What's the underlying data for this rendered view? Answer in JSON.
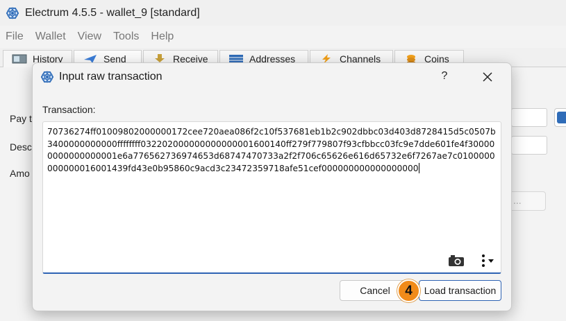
{
  "window": {
    "title": "Electrum 4.5.5  -  wallet_9  [standard]"
  },
  "menu": {
    "items": [
      "File",
      "Wallet",
      "View",
      "Tools",
      "Help"
    ]
  },
  "tabs": [
    {
      "label": "History",
      "icon": "history-icon"
    },
    {
      "label": "Send",
      "icon": "send-icon"
    },
    {
      "label": "Receive",
      "icon": "receive-icon"
    },
    {
      "label": "Addresses",
      "icon": "addresses-icon"
    },
    {
      "label": "Channels",
      "icon": "channels-icon"
    },
    {
      "label": "Coins",
      "icon": "coins-icon"
    }
  ],
  "send_form": {
    "pay_to_label": "Pay t",
    "description_label": "Desc",
    "amount_label": "Amo",
    "more_button": "..."
  },
  "dialog": {
    "title": "Input raw transaction",
    "help": "?",
    "transaction_label": "Transaction:",
    "transaction_text": "70736274ff01009802000000172cee720aea086f2c10f537681eb1b2c902dbbc03d403d8728415d5c0507b3400000000000ffffffff032202000000000000001600140ff279f779807f93cfbbcc03fc9e7dde601fe4f300000000000000001e6a776562736974653d68747470733a2f2f706c65626e616d65732e6f7267ae7c0100000000000016001439fd43e0b95860c9acd3c23472359718afe51cef000000000000000000",
    "cancel_label": "Cancel",
    "load_label": "Load transaction",
    "step_badge": "4"
  },
  "colors": {
    "accent": "#2d62b3",
    "badge": "#f18b1a",
    "electrum_blue": "#2f6cb8"
  }
}
